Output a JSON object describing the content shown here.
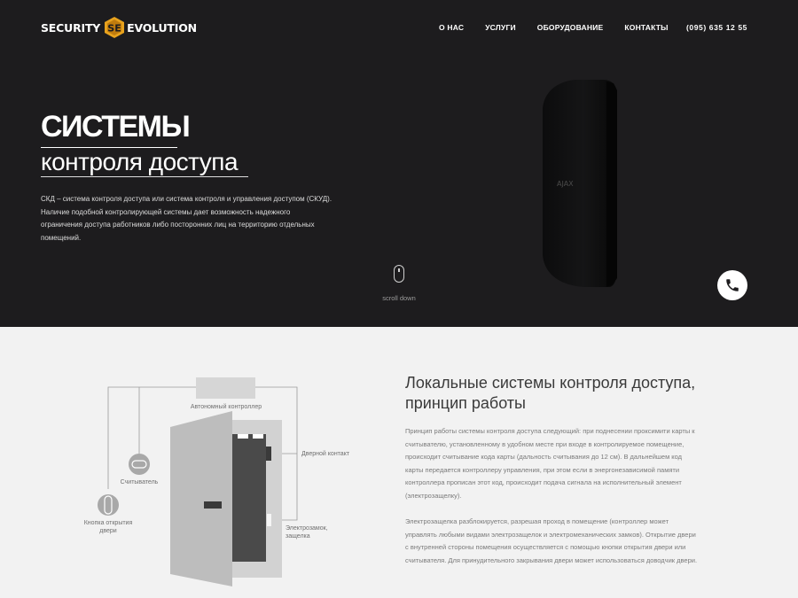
{
  "header": {
    "logo_left": "SECURITY",
    "logo_right": "EVOLUTION",
    "logo_badge": "SE",
    "nav": [
      "О НАС",
      "УСЛУГИ",
      "ОБОРУДОВАНИЕ",
      "КОНТАКТЫ"
    ],
    "phone": "(095) 635 12 55"
  },
  "hero": {
    "title": "СИСТЕМЫ",
    "subtitle": "контроля доступа",
    "description": "СКД – система контроля доступа или система контроля и управления доступом (СКУД). Наличие подобной контролирующей системы дает возможность надежного ограничения доступа работников либо посторонних лиц на территорию отдельных помещений.",
    "device_brand": "AJAX",
    "scroll_label": "scroll down"
  },
  "diagram": {
    "controller": "Автономный контроллер",
    "reader": "Считыватель",
    "exit_button": "Кнопка открытия двери",
    "door_contact": "Дверной контакт",
    "lock": "Электрозамок, защелка"
  },
  "section": {
    "title": "Локальные системы контроля доступа, принцип работы",
    "paragraph1": "Принцип работы системы контроля доступа следующий: при поднесении проксимити карты к считывателю, установленному в удобном месте при входе в контролируемое помещение, происходит считывание кода карты (дальность считывания до 12 см). В дальнейшем код карты передается контроллеру управления, при этом если в энергонезависимой памяти контроллера прописан этот код, происходит подача сигнала на исполнительный элемент (электрозащелку).",
    "paragraph2": "Электрозащелка разблокируется, разрешая проход в помещение (контроллер может управлять любыми видами электрозащелок и электромеханических замков). Открытие двери с внутренней стороны помещения осуществляется с помощью кнопки открытия двери или считывателя. Для принудительного закрывания двери может использоваться доводчик двери."
  },
  "colors": {
    "hero_bg": "#1d1c1e",
    "content_bg": "#f2f2f2",
    "logo_accent": "#e8a21d"
  },
  "icons": [
    "logo-badge-icon",
    "mouse-icon",
    "phone-icon",
    "reader-icon",
    "exit-button-icon"
  ]
}
